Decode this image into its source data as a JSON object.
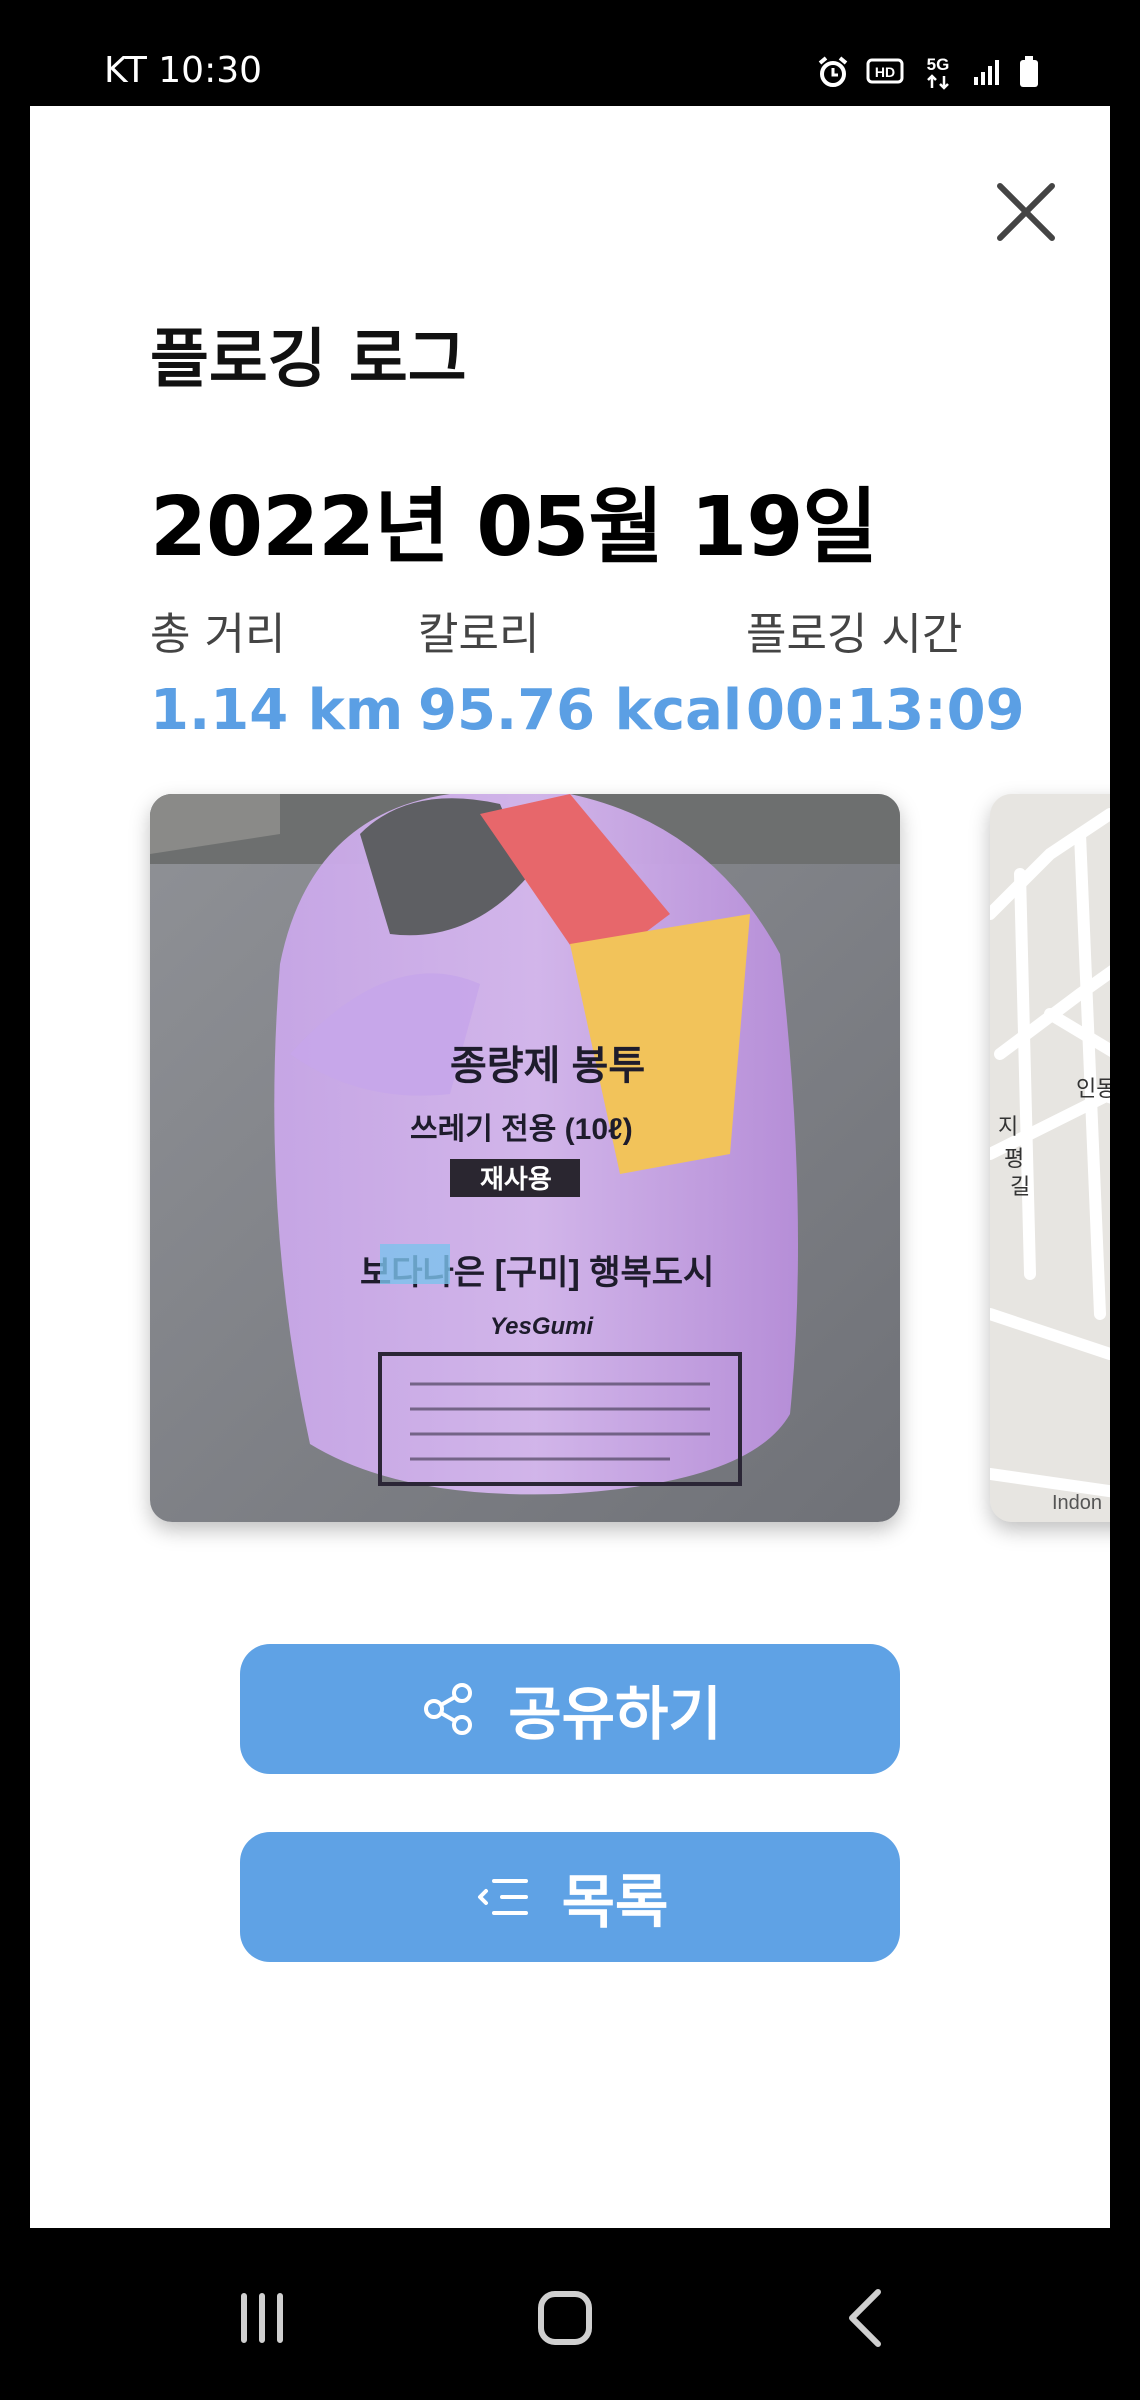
{
  "status_bar": {
    "carrier": "KT",
    "time": "10:30",
    "icons": [
      "alarm-icon",
      "hd-icon",
      "5g-icon",
      "signal-icon",
      "battery-icon"
    ]
  },
  "header": {
    "title": "플로깅 로그",
    "close_icon": "close-icon"
  },
  "log": {
    "date": "2022년 05월 19일",
    "stats": [
      {
        "label": "총 거리",
        "value": "1.14 km"
      },
      {
        "label": "칼로리",
        "value": "95.76 kcal"
      },
      {
        "label": "플로깅 시간",
        "value": "00:13:09"
      }
    ]
  },
  "carousel": {
    "photo_bag_text": [
      "종량제 봉투",
      "쓰레기 전용 (10ℓ)",
      "재사용",
      "보다나은 [구미] 행복도시",
      "YesGumi"
    ],
    "map_labels": [
      "인동",
      "지",
      "평",
      "길",
      "Indon"
    ]
  },
  "actions": {
    "share_label": "공유하기",
    "list_label": "목록"
  },
  "colors": {
    "accent": "#5b9fe4",
    "button": "#5fa2e5",
    "title": "#111111"
  },
  "nav_bar": {
    "icons": [
      "recent-apps-icon",
      "home-icon",
      "back-icon"
    ]
  }
}
